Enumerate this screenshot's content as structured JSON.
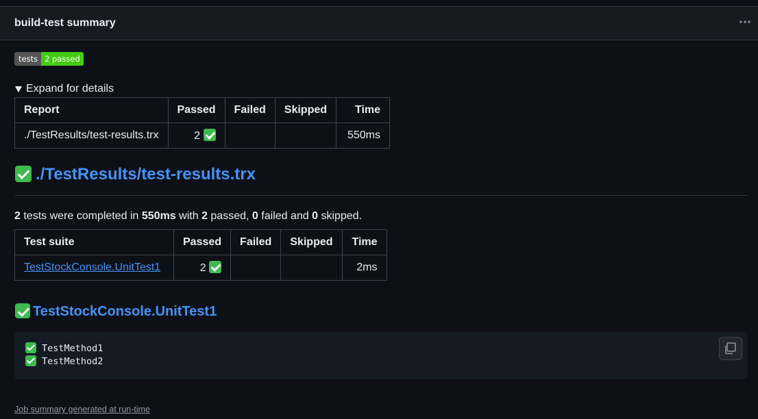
{
  "header": {
    "title": "build-test summary"
  },
  "badge": {
    "label": "tests",
    "value": "2 passed",
    "label_color": "#555555",
    "value_color": "#44cc11"
  },
  "details": {
    "summary": "Expand for details"
  },
  "report_table": {
    "headers": [
      "Report",
      "Passed",
      "Failed",
      "Skipped",
      "Time"
    ],
    "row": {
      "report": "./TestResults/test-results.trx",
      "passed": "2",
      "failed": "",
      "skipped": "",
      "time": "550ms"
    }
  },
  "result_heading": {
    "text": "./TestResults/test-results.trx"
  },
  "summary_line": {
    "tests_count": "2",
    "part1": " tests were completed in ",
    "duration": "550ms",
    "part2": " with ",
    "passed": "2",
    "part3": " passed, ",
    "failed": "0",
    "part4": " failed and ",
    "skipped": "0",
    "part5": " skipped."
  },
  "suite_table": {
    "headers": [
      "Test suite",
      "Passed",
      "Failed",
      "Skipped",
      "Time"
    ],
    "row": {
      "suite": "TestStockConsole.UnitTest1",
      "passed": "2",
      "failed": "",
      "skipped": "",
      "time": "2ms"
    }
  },
  "suite_heading": {
    "text": "TestStockConsole.UnitTest1"
  },
  "test_methods": [
    "TestMethod1",
    "TestMethod2"
  ],
  "icons": {
    "status": "check-mark-icon",
    "copy": "copy-icon",
    "menu": "kebab-menu-icon"
  },
  "colors": {
    "link": "#4493f8",
    "success": "#3fb950",
    "background": "#0d1117"
  },
  "footer": {
    "text": "Job summary generated at run-time"
  }
}
